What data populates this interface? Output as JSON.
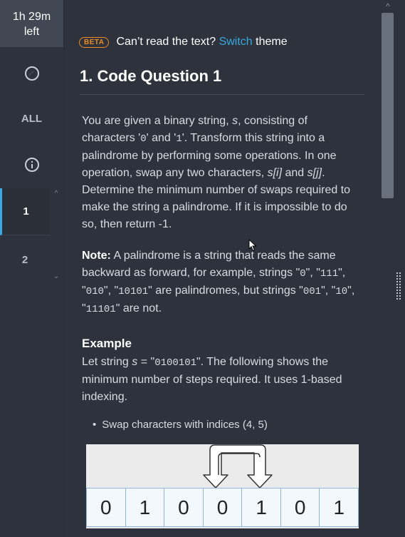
{
  "timer": {
    "line1": "1h 29m",
    "line2": "left"
  },
  "rail": {
    "all_label": "ALL",
    "questions": [
      "1",
      "2"
    ]
  },
  "theme_bar": {
    "beta": "BETA",
    "prefix": "Can’t read the text?",
    "link": "Switch",
    "suffix": "theme"
  },
  "question": {
    "title": "1. Code Question 1",
    "p1": {
      "a": "You are given a binary string, ",
      "s": "s",
      "b": ", consisting of characters '",
      "zero": "0",
      "c": "' and '",
      "one": "1",
      "d": "'. Transform this string into a palindrome by performing some operations. In one operation, swap any two characters, ",
      "si": "s[i]",
      "e": " and ",
      "sj": "s[j]",
      "f": ". Determine the minimum number of swaps required to make the string a palindrome. If it is impossible to do so, then return -1."
    },
    "note": {
      "label": "Note:",
      "a": " A palindrome is a string that reads the same backward as forward, for example, strings \"",
      "ex0": "0",
      "b": "\", \"",
      "ex111": "111",
      "c": "\", \"",
      "ex010": "010",
      "d": "\", \"",
      "ex10101": "10101",
      "e": "\" are palindromes, but strings \"",
      "ex001": "001",
      "f": "\", \"",
      "ex10": "10",
      "g": "\", \"",
      "ex11101": "11101",
      "h": "\" are not."
    },
    "example": {
      "heading": "Example",
      "a": "Let string ",
      "s": "s",
      "b": " = \"",
      "str": "0100101",
      "c": "\". The following shows the minimum number of steps required. It uses 1-based indexing."
    },
    "bullet": "Swap characters with indices (4, 5)",
    "diagram_cells": [
      "0",
      "1",
      "0",
      "0",
      "1",
      "0",
      "1"
    ]
  }
}
